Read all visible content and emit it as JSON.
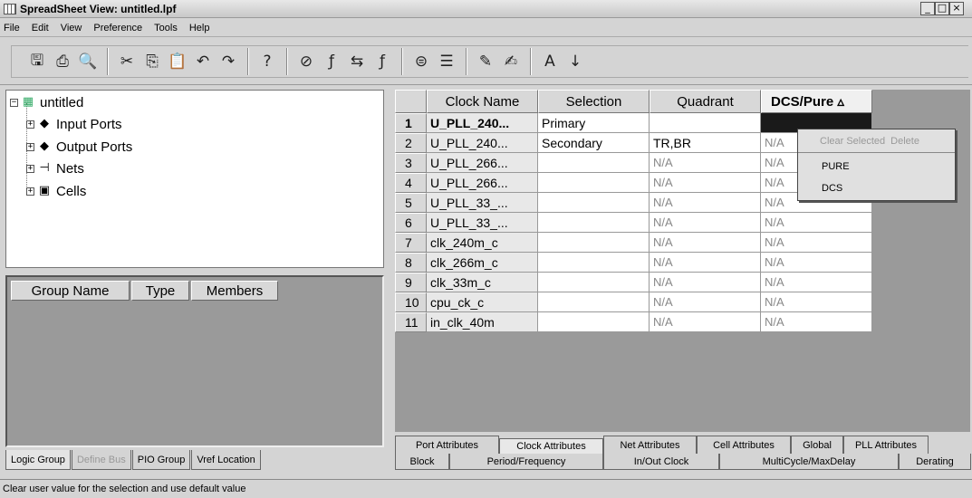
{
  "window": {
    "title": "SpreadSheet View: untitled.lpf",
    "controls": [
      "_",
      "□",
      "×"
    ]
  },
  "menu": [
    "File",
    "Edit",
    "View",
    "Preference",
    "Tools",
    "Help"
  ],
  "toolbar": {
    "buttons": [
      {
        "name": "save-icon",
        "glyph": "🖫"
      },
      {
        "name": "print-icon",
        "glyph": "⎙"
      },
      {
        "name": "print-preview-icon",
        "glyph": "🔍"
      },
      {
        "name": "cut-icon",
        "glyph": "✂"
      },
      {
        "name": "copy-icon",
        "glyph": "⎘"
      },
      {
        "name": "paste-icon",
        "glyph": "📋"
      },
      {
        "name": "undo-icon",
        "glyph": "↶"
      },
      {
        "name": "redo-icon",
        "glyph": "↷"
      },
      {
        "name": "help-icon",
        "glyph": "?"
      },
      {
        "name": "clear-icon",
        "glyph": "⊘"
      },
      {
        "name": "frequency-icon",
        "glyph": "ƒ"
      },
      {
        "name": "period-icon",
        "glyph": "⇆"
      },
      {
        "name": "multicycle-icon",
        "glyph": "ƒ"
      },
      {
        "name": "group-icon",
        "glyph": "⊜"
      },
      {
        "name": "ports-icon",
        "glyph": "☰"
      },
      {
        "name": "edit-icon",
        "glyph": "✎"
      },
      {
        "name": "sign-icon",
        "glyph": "✍"
      },
      {
        "name": "font-icon",
        "glyph": "A"
      },
      {
        "name": "sort-icon",
        "glyph": "↓"
      }
    ]
  },
  "tree": {
    "root": "untitled",
    "children": [
      "Input Ports",
      "Output Ports",
      "Nets",
      "Cells"
    ]
  },
  "groupTable": {
    "headers": [
      "Group Name",
      "Type",
      "Members"
    ]
  },
  "leftTabs": [
    "Logic Group",
    "Define Bus",
    "PIO Group",
    "Vref Location"
  ],
  "grid": {
    "headers": [
      "Clock Name",
      "Selection",
      "Quadrant",
      "DCS/Pure ▵"
    ],
    "rows": [
      {
        "num": "1",
        "name": "U_PLL_240...",
        "selection": "Primary",
        "quadrant": "",
        "dcs": ""
      },
      {
        "num": "2",
        "name": "U_PLL_240...",
        "selection": "Secondary",
        "quadrant": "TR,BR",
        "dcs": "N/A"
      },
      {
        "num": "3",
        "name": "U_PLL_266...",
        "selection": "",
        "quadrant": "N/A",
        "dcs": "N/A"
      },
      {
        "num": "4",
        "name": "U_PLL_266...",
        "selection": "",
        "quadrant": "N/A",
        "dcs": "N/A"
      },
      {
        "num": "5",
        "name": "U_PLL_33_...",
        "selection": "",
        "quadrant": "N/A",
        "dcs": "N/A"
      },
      {
        "num": "6",
        "name": "U_PLL_33_...",
        "selection": "",
        "quadrant": "N/A",
        "dcs": "N/A"
      },
      {
        "num": "7",
        "name": "clk_240m_c",
        "selection": "",
        "quadrant": "N/A",
        "dcs": "N/A"
      },
      {
        "num": "8",
        "name": "clk_266m_c",
        "selection": "",
        "quadrant": "N/A",
        "dcs": "N/A"
      },
      {
        "num": "9",
        "name": "clk_33m_c",
        "selection": "",
        "quadrant": "N/A",
        "dcs": "N/A"
      },
      {
        "num": "10",
        "name": "cpu_ck_c",
        "selection": "",
        "quadrant": "N/A",
        "dcs": "N/A"
      },
      {
        "num": "11",
        "name": "in_clk_40m",
        "selection": "",
        "quadrant": "N/A",
        "dcs": "N/A"
      }
    ]
  },
  "contextMenu": {
    "clearSelected": "Clear Selected",
    "delete": "Delete",
    "items": [
      "PURE",
      "DCS"
    ]
  },
  "bottomTabsTop": [
    "Port Attributes",
    "Clock Attributes",
    "Net Attributes",
    "Cell Attributes",
    "Global",
    "PLL Attributes"
  ],
  "bottomTabsBottom": [
    "Block",
    "Period/Frequency",
    "In/Out Clock",
    "MultiCycle/MaxDelay",
    "Derating"
  ],
  "status": "Clear user value for the selection and use default value"
}
